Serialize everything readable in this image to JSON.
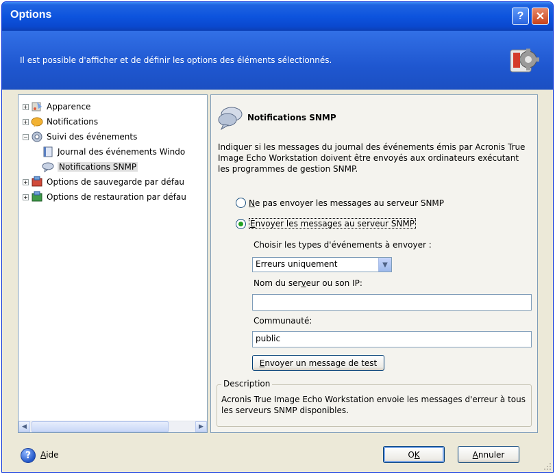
{
  "window": {
    "title": "Options",
    "help_glyph": "?",
    "close_glyph": "✕"
  },
  "banner": {
    "text": "Il est possible d'afficher et de définir les options des éléments sélectionnés.",
    "icon": "settings-gear-icon"
  },
  "tree": {
    "items": [
      {
        "label": "Apparence",
        "expander": "+",
        "icon": "appearance-icon"
      },
      {
        "label": "Notifications",
        "expander": "+",
        "icon": "notifications-icon"
      },
      {
        "label": "Suivi des événements",
        "expander": "−",
        "icon": "event-tracking-icon"
      },
      {
        "label": "Journal des événements Windo",
        "icon": "event-log-icon"
      },
      {
        "label": "Notifications SNMP",
        "icon": "snmp-icon",
        "selected": true
      },
      {
        "label": "Options de sauvegarde par défau",
        "expander": "+",
        "icon": "backup-options-icon"
      },
      {
        "label": "Options de restauration par défau",
        "expander": "+",
        "icon": "restore-options-icon"
      }
    ]
  },
  "panel": {
    "title": "Notifications SNMP",
    "description": "Indiquer si les messages du journal des événements émis par Acronis True Image Echo Workstation doivent être envoyés aux ordinateurs exécutant les programmes de gestion SNMP.",
    "radio_no": {
      "hotkey": "N",
      "rest": "e pas envoyer les messages au serveur SNMP",
      "checked": false
    },
    "radio_yes": {
      "hotkey": "E",
      "rest": "nvoyer les messages au serveur SNMP",
      "checked": true
    },
    "event_types_label": "Choisir les types d'événements à envoyer :",
    "event_types_value": "Erreurs uniquement",
    "server_label_a": "Nom du ser",
    "server_label_hotkey": "v",
    "server_label_b": "eur ou son IP:",
    "server_value": "",
    "community_label": "Communauté:",
    "community_value": "public",
    "test_button_hotkey": "E",
    "test_button_rest": "nvoyer un message de test",
    "description_group": {
      "legend": "Description",
      "text": "Acronis True Image Echo Workstation envoie les messages d'erreur à tous les serveurs SNMP disponibles."
    }
  },
  "footer": {
    "help_glyph": "?",
    "help_hotkey": "A",
    "help_rest": "ide",
    "ok_a": "O",
    "ok_hotkey": "K",
    "cancel_hotkey": "A",
    "cancel_rest": "nnuler"
  },
  "colors": {
    "titlebar": "#0a48cf",
    "banner": "#1f57d0",
    "radio_checked": "#21a121",
    "panel_border": "#7f9db9"
  }
}
